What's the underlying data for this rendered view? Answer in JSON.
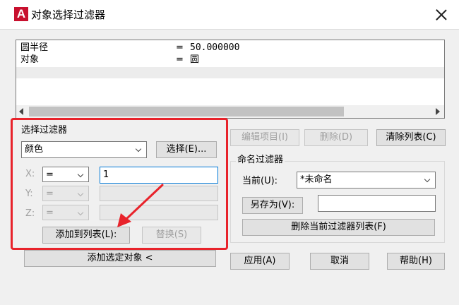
{
  "window": {
    "title": "对象选择过滤器"
  },
  "list": {
    "rows": [
      {
        "key": "圆半径",
        "eq": "=",
        "value": "50.000000"
      },
      {
        "key": "对象",
        "eq": "=",
        "value": "圆"
      }
    ]
  },
  "filter_group": {
    "title": "选择过滤器",
    "type_value": "颜色",
    "select_button": "选择(E)...",
    "x_label": "X:",
    "y_label": "Y:",
    "z_label": "Z:",
    "x_op": "=",
    "y_op": "=",
    "z_op": "=",
    "x_value": "1",
    "add_to_list": "添加到列表(L):",
    "replace": "替换(S)"
  },
  "add_selected": "添加选定对象 <",
  "list_buttons": {
    "edit": "编辑项目(I)",
    "delete": "删除(D)",
    "clear": "清除列表(C)"
  },
  "named_filters": {
    "title": "命名过滤器",
    "current_label": "当前(U):",
    "current_value": "*未命名",
    "save_as": "另存为(V):",
    "save_as_value": "",
    "delete_current": "删除当前过滤器列表(F)"
  },
  "footer": {
    "apply": "应用(A)",
    "cancel": "取消",
    "help": "帮助(H)"
  },
  "colors": {
    "highlight": "#e8232b",
    "focus": "#0078d7",
    "app_icon": "#c8102e"
  }
}
